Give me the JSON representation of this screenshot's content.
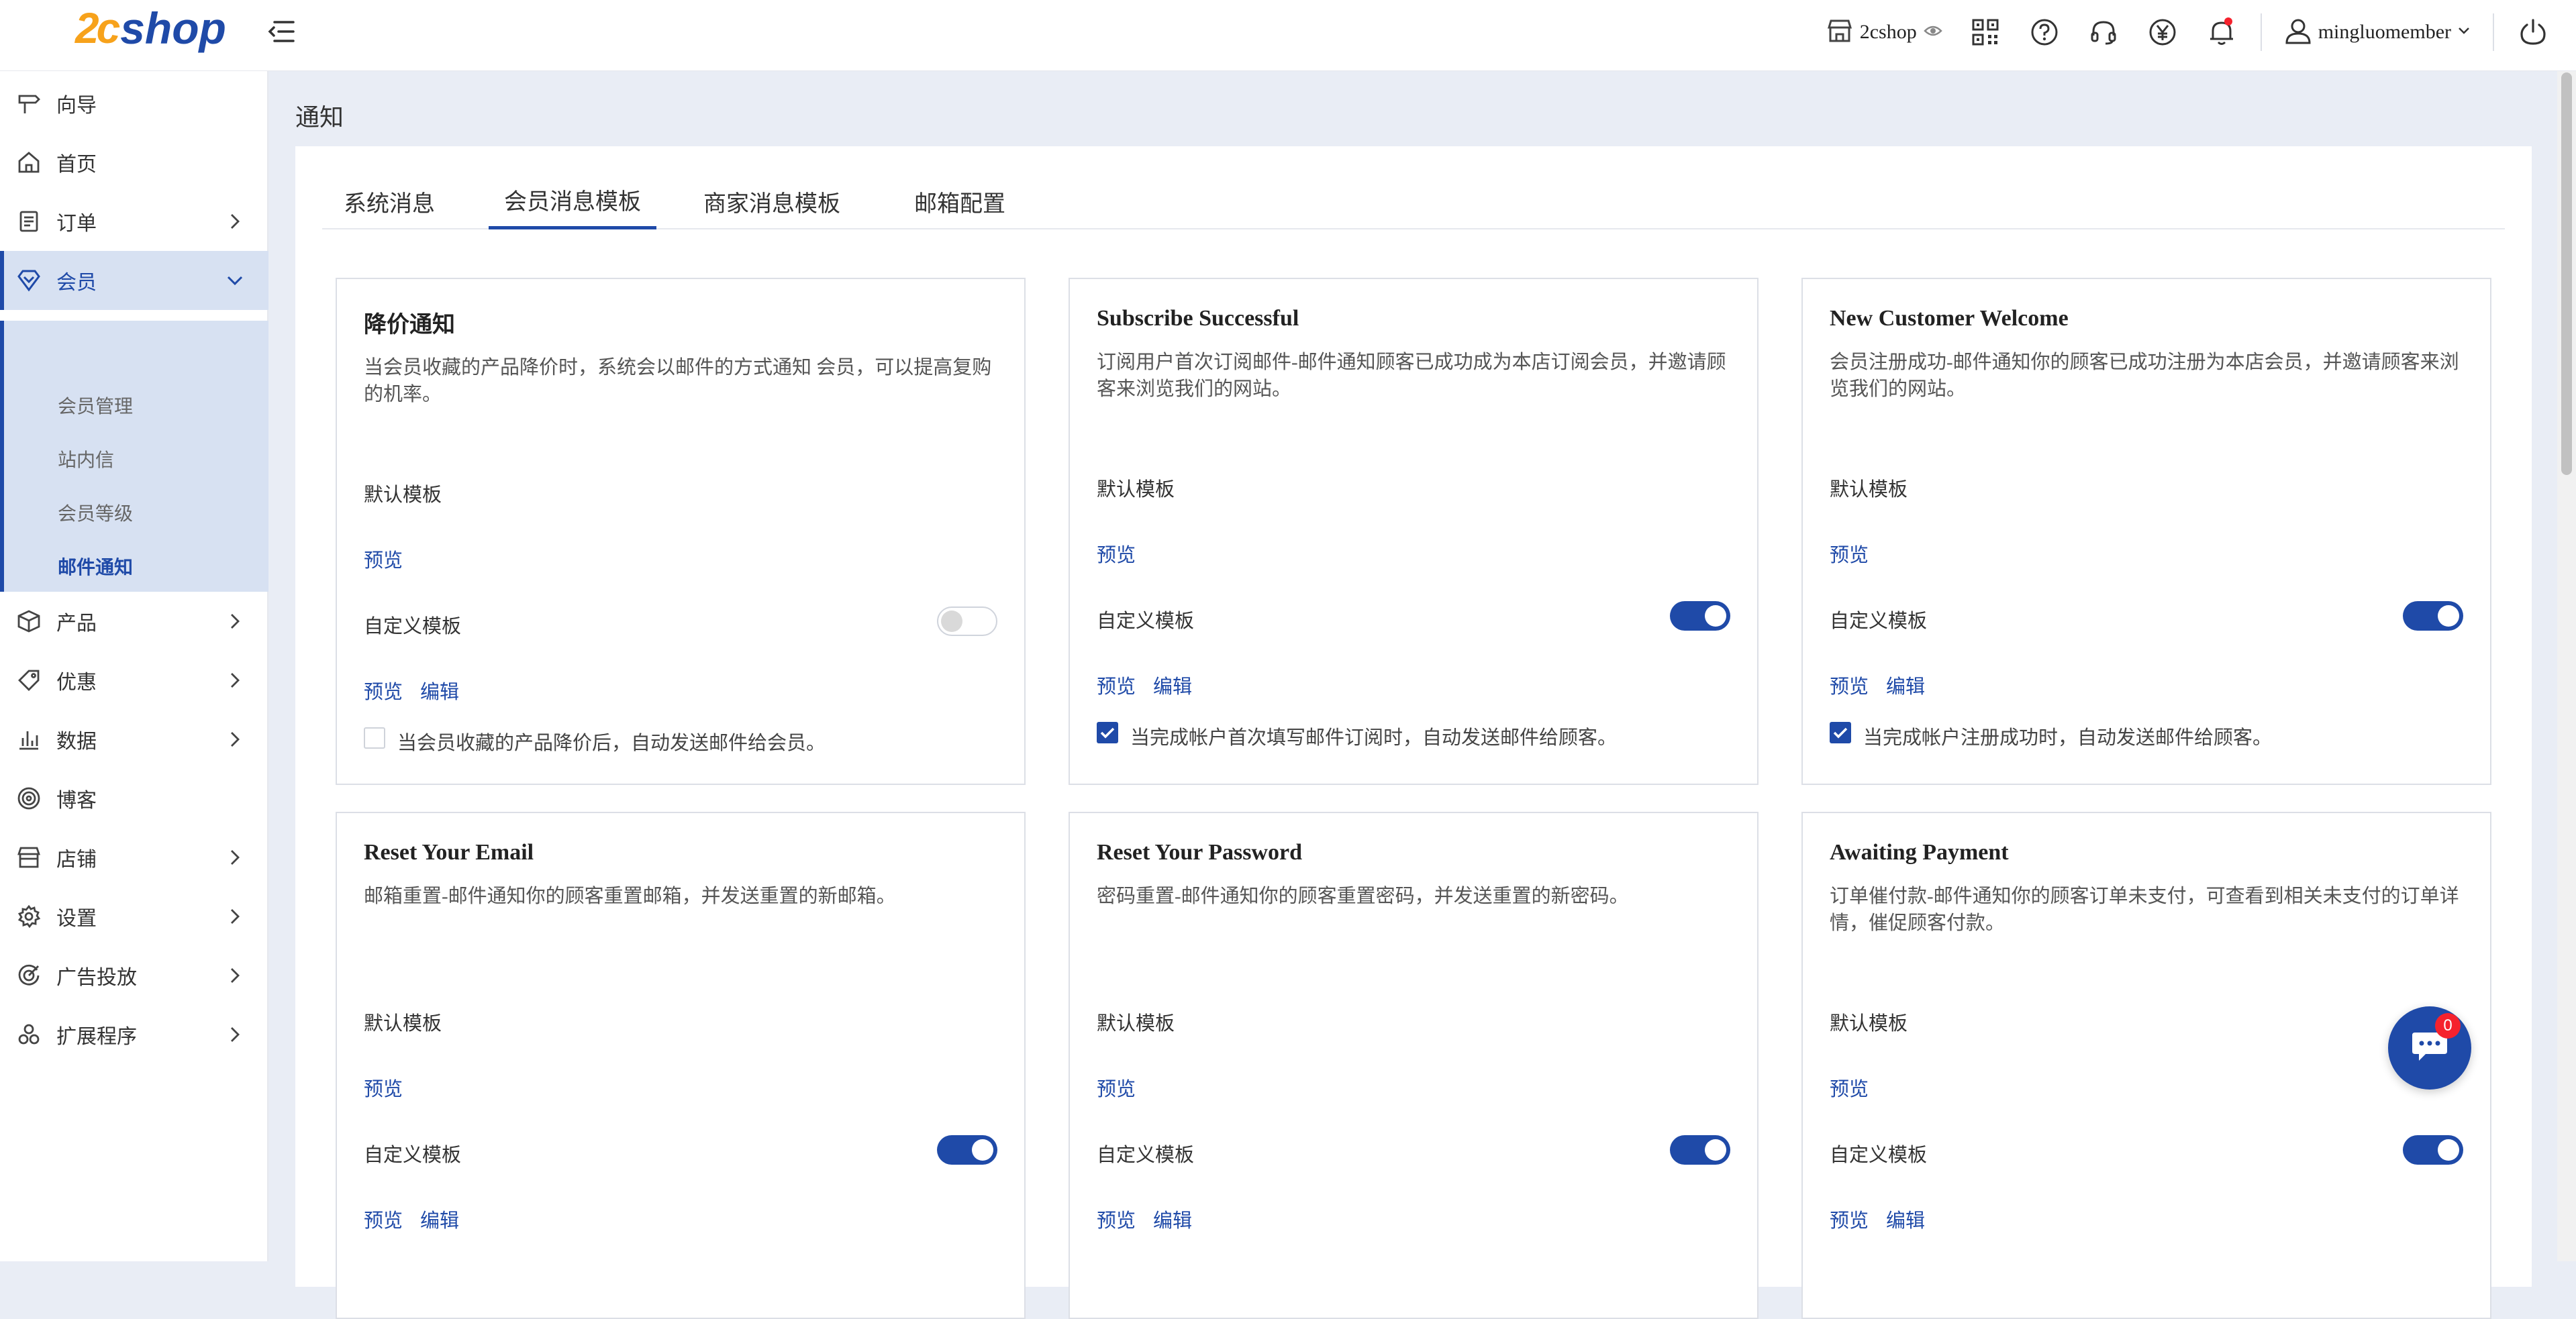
{
  "header": {
    "logo_mark": "2c",
    "logo_word": "shop",
    "store_name": "2cshop",
    "username": "mingluomember"
  },
  "sidebar": {
    "items": [
      {
        "label": "向导",
        "icon": "signpost-icon"
      },
      {
        "label": "首页",
        "icon": "home-icon"
      },
      {
        "label": "订单",
        "icon": "order-icon"
      },
      {
        "label": "会员",
        "icon": "member-icon"
      },
      {
        "label": "产品",
        "icon": "box-icon"
      },
      {
        "label": "优惠",
        "icon": "tag-icon"
      },
      {
        "label": "数据",
        "icon": "chart-icon"
      },
      {
        "label": "博客",
        "icon": "blog-icon"
      },
      {
        "label": "店铺",
        "icon": "store-icon"
      },
      {
        "label": "设置",
        "icon": "gear-icon"
      },
      {
        "label": "广告投放",
        "icon": "target-icon"
      },
      {
        "label": "扩展程序",
        "icon": "extension-icon"
      }
    ],
    "sub_items": [
      "会员管理",
      "站内信",
      "会员等级",
      "邮件通知"
    ]
  },
  "page": {
    "title": "通知",
    "tabs": [
      "系统消息",
      "会员消息模板",
      "商家消息模板",
      "邮箱配置"
    ],
    "active_tab": "会员消息模板"
  },
  "labels": {
    "default_template": "默认模板",
    "custom_template": "自定义模板",
    "preview": "预览",
    "edit": "编辑"
  },
  "cards": [
    {
      "title": "降价通知",
      "desc": "当会员收藏的产品降价时，系统会以邮件的方式通知 会员，可以提高复购的机率。",
      "custom_enabled": false,
      "auto_send_checked": false,
      "auto_send_label": "当会员收藏的产品降价后，自动发送邮件给会员。"
    },
    {
      "title": "Subscribe Successful",
      "desc": "订阅用户首次订阅邮件-邮件通知顾客已成功成为本店订阅会员，并邀请顾客来浏览我们的网站。",
      "custom_enabled": true,
      "auto_send_checked": true,
      "auto_send_label": "当完成帐户首次填写邮件订阅时，自动发送邮件给顾客。"
    },
    {
      "title": "New Customer Welcome",
      "desc": "会员注册成功-邮件通知你的顾客已成功注册为本店会员，并邀请顾客来浏览我们的网站。",
      "custom_enabled": true,
      "auto_send_checked": true,
      "auto_send_label": "当完成帐户注册成功时，自动发送邮件给顾客。"
    },
    {
      "title": "Reset Your Email",
      "desc": "邮箱重置-邮件通知你的顾客重置邮箱，并发送重置的新邮箱。",
      "custom_enabled": true
    },
    {
      "title": "Reset Your Password",
      "desc": "密码重置-邮件通知你的顾客重置密码，并发送重置的新密码。",
      "custom_enabled": true
    },
    {
      "title": "Awaiting Payment",
      "desc": "订单催付款-邮件通知你的顾客订单未支付，可查看到相关未支付的订单详情，催促顾客付款。",
      "custom_enabled": true
    }
  ],
  "chat": {
    "badge": "0"
  },
  "colors": {
    "primary": "#1f4aa8",
    "accent": "#f7a21b",
    "active_bg": "#d7e1f2",
    "badge": "#f5222d"
  }
}
